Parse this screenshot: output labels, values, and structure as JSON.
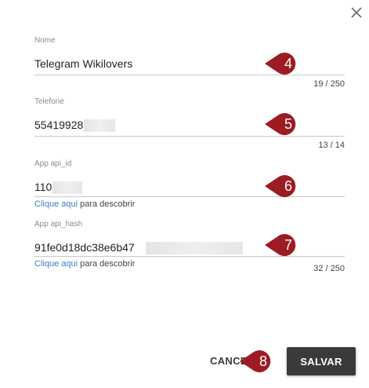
{
  "dialog": {
    "close_icon": "close-icon",
    "fields": {
      "nome": {
        "label": "Nome",
        "value": "Telegram Wikilovers",
        "counter": "19 / 250"
      },
      "telefone": {
        "label": "Telefone",
        "value": "55419928",
        "counter": "13 / 14"
      },
      "api_id": {
        "label": "App api_id",
        "value": "110",
        "helper_link": "Clique aqui",
        "helper_text": " para descobrir"
      },
      "api_hash": {
        "label": "App api_hash",
        "value": "91fe0d18dc38e6b47",
        "helper_link": "Clique aqui",
        "helper_text": " para descobrir",
        "counter": "32 / 250"
      }
    },
    "markers": [
      "4",
      "5",
      "6",
      "7",
      "8"
    ],
    "actions": {
      "cancel_label": "CANCELAR",
      "save_label": "SALVAR"
    },
    "colors": {
      "marker": "#9b1c22",
      "save_bg": "#3a3a3a",
      "link": "#3d7cc9"
    }
  }
}
